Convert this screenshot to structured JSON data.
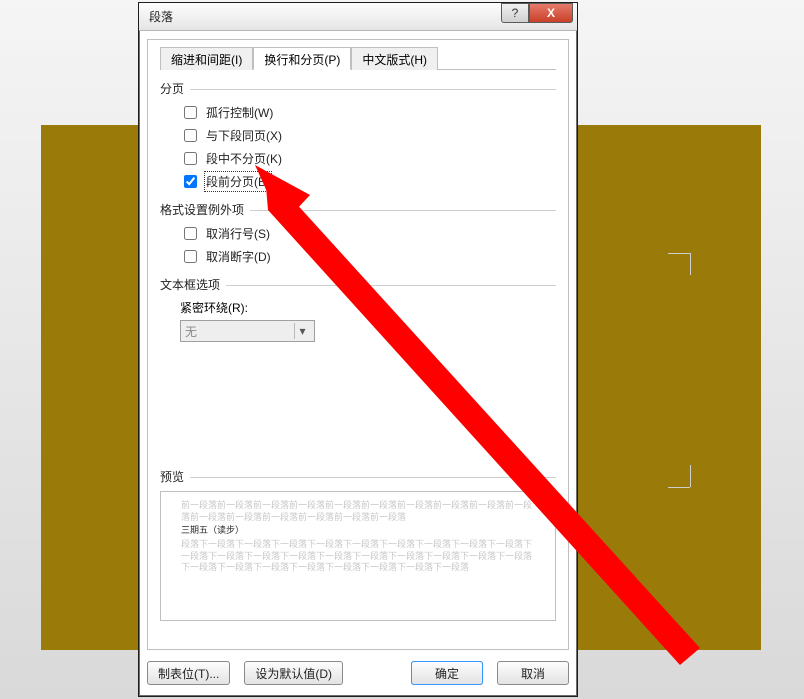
{
  "dialog": {
    "title": "段落",
    "help_label": "?",
    "close_label": "X"
  },
  "tabs": {
    "indent": "缩进和间距(I)",
    "page": "换行和分页(P)",
    "cjk": "中文版式(H)"
  },
  "group_pagination": "分页",
  "checks": {
    "widow": "孤行控制(W)",
    "keep_next": "与下段同页(X)",
    "keep_lines": "段中不分页(K)",
    "page_break": "段前分页(B)"
  },
  "group_format_exceptions": "格式设置例外项",
  "checks2": {
    "suppress_line_no": "取消行号(S)",
    "suppress_hyphen": "取消断字(D)"
  },
  "group_textbox": "文本框选项",
  "wrap_label": "紧密环绕(R):",
  "wrap_value": "无",
  "group_preview": "预览",
  "preview": {
    "before": "前一段落前一段落前一段落前一段落前一段落前一段落前一段落前一段落前一段落前一段落前一段落前一段落前一段落前一段落前一段落前一段落",
    "mid": "三期五（读步）",
    "after": "段落下一段落下一段落下一段落下一段落下一段落下一段落下一段落下一段落下一段落下一段落下一段落下一段落下一段落下一段落下一段落下一段落下一段落下一段落下一段落下一段落下一段落下一段落下一段落下一段落下一段落下一段落下一段落"
  },
  "buttons": {
    "tabs": "制表位(T)...",
    "defaults": "设为默认值(D)",
    "ok": "确定",
    "cancel": "取消"
  }
}
